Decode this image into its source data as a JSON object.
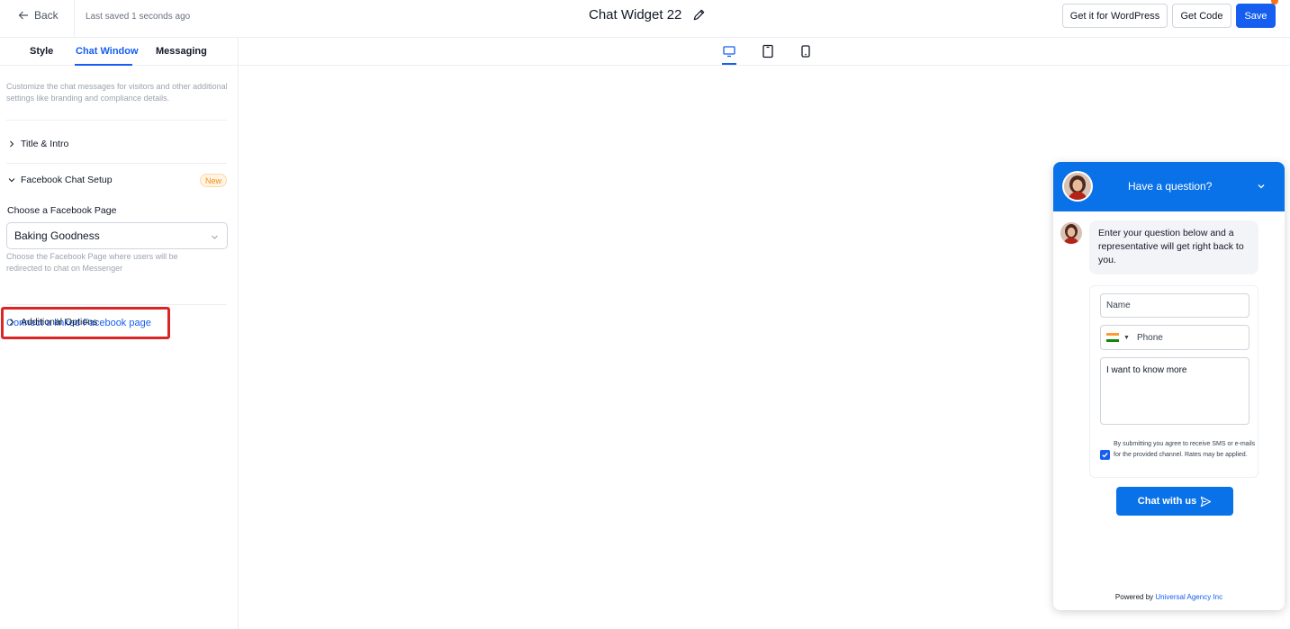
{
  "topbar": {
    "back_label": "Back",
    "saved_text": "Last saved 1 seconds ago",
    "title": "Chat Widget 22",
    "wordpress_label": "Get it for WordPress",
    "get_code_label": "Get Code",
    "save_label": "Save"
  },
  "left_panel": {
    "tabs": [
      {
        "label": "Style"
      },
      {
        "label": "Chat Window",
        "active": true
      },
      {
        "label": "Messaging"
      }
    ],
    "description": "Customize the chat messages for visitors and other additional settings like branding and compliance details.",
    "sections": {
      "title_intro": "Title & Intro",
      "facebook_setup": "Facebook Chat Setup",
      "new_badge": "New",
      "additional_options": "Additional Options"
    },
    "facebook": {
      "field_label": "Choose a Facebook Page",
      "selected_page": "Baking Goodness",
      "helper_text": "Choose the Facebook Page where users will be redirected to chat on Messenger",
      "connect_link": "Connect a linked Facebook page"
    }
  },
  "device_toolbar": {
    "devices": [
      "desktop-icon",
      "tablet-icon",
      "mobile-icon"
    ],
    "active": "desktop"
  },
  "widget": {
    "header_title": "Have a question?",
    "intro_message": "Enter your question below and a representative will get right back to you.",
    "name_placeholder": "Name",
    "phone_placeholder": "Phone",
    "message_value": "I want to know more",
    "consent_text": "By submitting you agree to receive SMS or e-mails for the provided channel. Rates may be applied.",
    "consent_checked": true,
    "chat_button_label": "Chat with us",
    "powered_by": "Powered by",
    "agency_name": "Universal Agency Inc",
    "accent_color": "#0a72e8"
  },
  "colors": {
    "primary": "#155eef",
    "highlight_border": "#dc2626",
    "badge_text": "#f79009"
  }
}
